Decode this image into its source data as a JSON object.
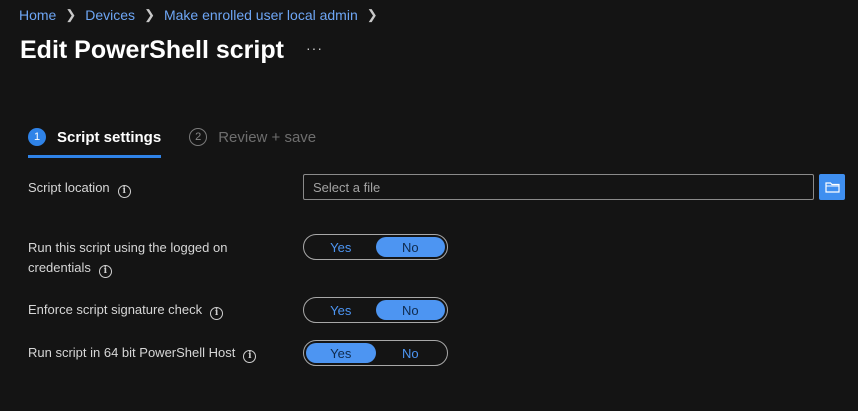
{
  "breadcrumb": {
    "items": [
      "Home",
      "Devices",
      "Make enrolled user local admin"
    ]
  },
  "page": {
    "title": "Edit PowerShell script",
    "more_label": "···"
  },
  "wizard": {
    "steps": [
      {
        "number": "1",
        "label": "Script settings",
        "state": "active"
      },
      {
        "number": "2",
        "label": "Review + save",
        "state": "inactive"
      }
    ]
  },
  "form": {
    "script_location": {
      "label": "Script location",
      "placeholder": "Select a file",
      "value": ""
    },
    "logged_on_credentials": {
      "label_line1": "Run this script using the logged on",
      "label_line2": "credentials",
      "options": [
        "Yes",
        "No"
      ],
      "selected": "No"
    },
    "signature_check": {
      "label": "Enforce script signature check",
      "options": [
        "Yes",
        "No"
      ],
      "selected": "No"
    },
    "run_64bit": {
      "label": "Run script in 64 bit PowerShell Host",
      "options": [
        "Yes",
        "No"
      ],
      "selected": "Yes"
    }
  },
  "icons": {
    "info": "info-icon",
    "browse": "folder-icon",
    "chevron": "chevron-right-icon"
  },
  "colors": {
    "accent": "#2f83e8",
    "link": "#6ea6f5",
    "background": "#141414"
  }
}
